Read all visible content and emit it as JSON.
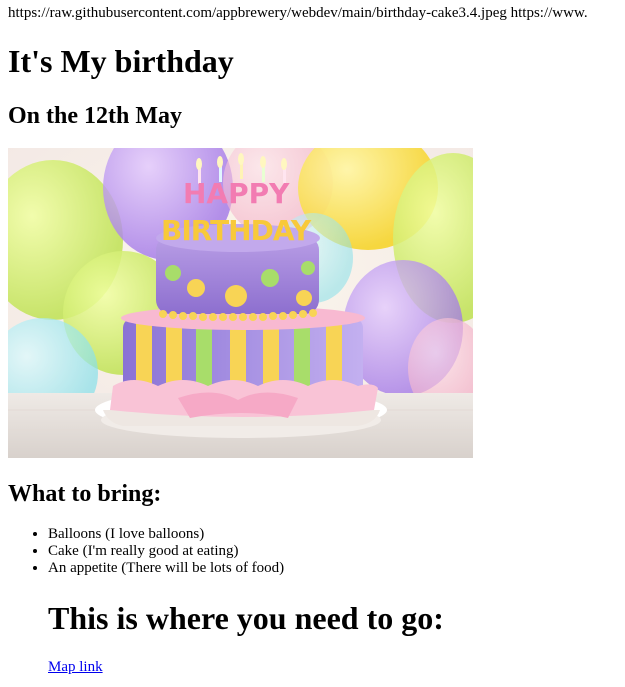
{
  "url_text": "https://raw.githubusercontent.com/appbrewery/webdev/main/birthday-cake3.4.jpeg https://www.",
  "title": "It's My birthday",
  "date_heading": "On the 12th May",
  "cake_image": {
    "topper_word_1": "HAPPY",
    "topper_word_2": "BIRTHDAY"
  },
  "bring": {
    "heading": "What to bring:",
    "items": [
      "Balloons (I love balloons)",
      "Cake (I'm really good at eating)",
      "An appetite (There will be lots of food)"
    ]
  },
  "go_heading": "This is where you need to go:",
  "map_link_label": "Map link",
  "colors": {
    "link": "#0000ee",
    "text": "#000000",
    "background": "#ffffff"
  }
}
